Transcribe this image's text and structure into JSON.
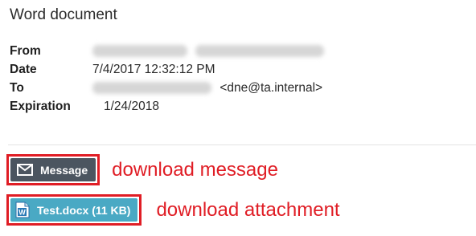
{
  "title": "Word document",
  "meta": {
    "from_label": "From",
    "date_label": "Date",
    "date_value": "7/4/2017 12:32:12 PM",
    "to_label": "To",
    "to_email": "<dne@ta.internal>",
    "expiration_label": "Expiration",
    "expiration_value": "1/24/2018"
  },
  "buttons": {
    "message_label": "Message",
    "attachment_label": "Test.docx (11 KB)"
  },
  "annotations": {
    "message": "download message",
    "attachment": "download attachment"
  },
  "icons": {
    "message": "envelope-icon",
    "attachment": "word-document-icon"
  },
  "colors": {
    "highlight": "#e01d25",
    "message_button": "#4b5560",
    "attachment_button": "#4aa9c4"
  }
}
